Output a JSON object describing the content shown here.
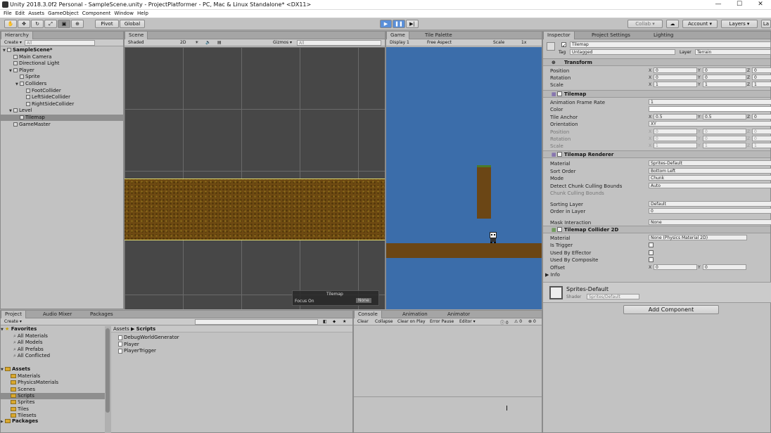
{
  "window": {
    "title": "Unity 2018.3.0f2 Personal - SampleScene.unity - ProjectPlatformer - PC, Mac & Linux Standalone* <DX11>",
    "minimize": "—",
    "maximize": "☐",
    "close": "✕"
  },
  "menu": [
    "File",
    "Edit",
    "Assets",
    "GameObject",
    "Component",
    "Window",
    "Help"
  ],
  "toolbar": {
    "pivot": "Pivot",
    "global": "Global",
    "collab": "Collab ▾",
    "account": "Account ▾",
    "layers": "Layers ▾",
    "layout": "La"
  },
  "hierarchy": {
    "tab": "Hierarchy",
    "create": "Create ▾",
    "search_placeholder": "All",
    "items": [
      {
        "label": "SampleScene*",
        "depth": 0,
        "expanded": true
      },
      {
        "label": "Main Camera",
        "depth": 1
      },
      {
        "label": "Directional Light",
        "depth": 1
      },
      {
        "label": "Player",
        "depth": 1,
        "expanded": true
      },
      {
        "label": "Sprite",
        "depth": 2
      },
      {
        "label": "Colliders",
        "depth": 2,
        "expanded": true
      },
      {
        "label": "FootCollider",
        "depth": 3
      },
      {
        "label": "LeftSideCollider",
        "depth": 3
      },
      {
        "label": "RightSideCollider",
        "depth": 3
      },
      {
        "label": "Level",
        "depth": 1,
        "expanded": true
      },
      {
        "label": "Tilemap",
        "depth": 2,
        "selected": true
      },
      {
        "label": "GameMaster",
        "depth": 1
      }
    ]
  },
  "scene": {
    "tab": "Scene",
    "shading": "Shaded",
    "mode2d": "2D",
    "gizmos": "Gizmos ▾",
    "search_placeholder": "All",
    "overlay_title": "Tilemap",
    "focus_label": "Focus On",
    "focus_value": "None"
  },
  "game": {
    "tab": "Game",
    "tab2": "Tile Palette",
    "display": "Display 1",
    "aspect": "Free Aspect",
    "scale_label": "Scale",
    "scale_value": "1x"
  },
  "inspector": {
    "tabs": [
      "Inspector",
      "Project Settings",
      "Lighting"
    ],
    "object_name": "Tilemap",
    "tag_label": "Tag",
    "tag_value": "Untagged",
    "layer_label": "Layer",
    "layer_value": "Terrain",
    "transform": {
      "title": "Transform",
      "position_label": "Position",
      "position": [
        "0",
        "0",
        "0"
      ],
      "rotation_label": "Rotation",
      "rotation": [
        "0",
        "0",
        "0"
      ],
      "scale_label": "Scale",
      "scale": [
        "1",
        "1",
        "1"
      ]
    },
    "tilemap": {
      "title": "Tilemap",
      "frame_rate_label": "Animation Frame Rate",
      "frame_rate": "1",
      "color_label": "Color",
      "anchor_label": "Tile Anchor",
      "anchor": [
        "0.5",
        "0.5",
        "0"
      ],
      "orientation_label": "Orientation",
      "orientation": "XY",
      "position_label": "Position",
      "position": [
        "0",
        "0",
        "0"
      ],
      "rotation_label": "Rotation",
      "rotation": [
        "0",
        "0",
        "0"
      ],
      "scale_label": "Scale",
      "scale": [
        "1",
        "1",
        "1"
      ]
    },
    "renderer": {
      "title": "Tilemap Renderer",
      "material_label": "Material",
      "material": "Sprites-Default",
      "sort_label": "Sort Order",
      "sort": "Bottom Left",
      "mode_label": "Mode",
      "mode": "Chunk",
      "detect_label": "Detect Chunk Culling Bounds",
      "detect": "Auto",
      "bounds_label": "Chunk Culling Bounds",
      "sorting_layer_label": "Sorting Layer",
      "sorting_layer": "Default",
      "order_label": "Order in Layer",
      "order": "0",
      "mask_label": "Mask Interaction",
      "mask": "None"
    },
    "collider": {
      "title": "Tilemap Collider 2D",
      "material_label": "Material",
      "material": "None (Physics Material 2D)",
      "trigger_label": "Is Trigger",
      "effector_label": "Used By Effector",
      "composite_label": "Used By Composite",
      "offset_label": "Offset",
      "offset": [
        "0",
        "0"
      ],
      "info_label": "Info"
    },
    "material_preview": {
      "name": "Sprites-Default",
      "shader_label": "Shader",
      "shader": "Sprites/Default"
    },
    "add_component": "Add Component"
  },
  "project": {
    "tabs": [
      "Project",
      "Audio Mixer",
      "Packages"
    ],
    "create": "Create ▾",
    "favorites": {
      "title": "Favorites",
      "items": [
        "All Materials",
        "All Models",
        "All Prefabs",
        "All Conflicted"
      ]
    },
    "assets": {
      "title": "Assets",
      "items": [
        "Materials",
        "PhysicsMaterials",
        "Scenes",
        "Scripts",
        "Sprites",
        "Tiles",
        "Tilesets"
      ],
      "selected": "Scripts"
    },
    "packages_title": "Packages",
    "breadcrumb": [
      "Assets",
      "Scripts"
    ],
    "files": [
      "DebugWorldGenerator",
      "Player",
      "PlayerTrigger"
    ]
  },
  "console": {
    "tabs": [
      "Console",
      "Animation",
      "Animator"
    ],
    "buttons": [
      "Clear",
      "Collapse",
      "Clear on Play",
      "Error Pause",
      "Editor ▾"
    ],
    "counts": [
      "0",
      "0",
      "0"
    ]
  }
}
